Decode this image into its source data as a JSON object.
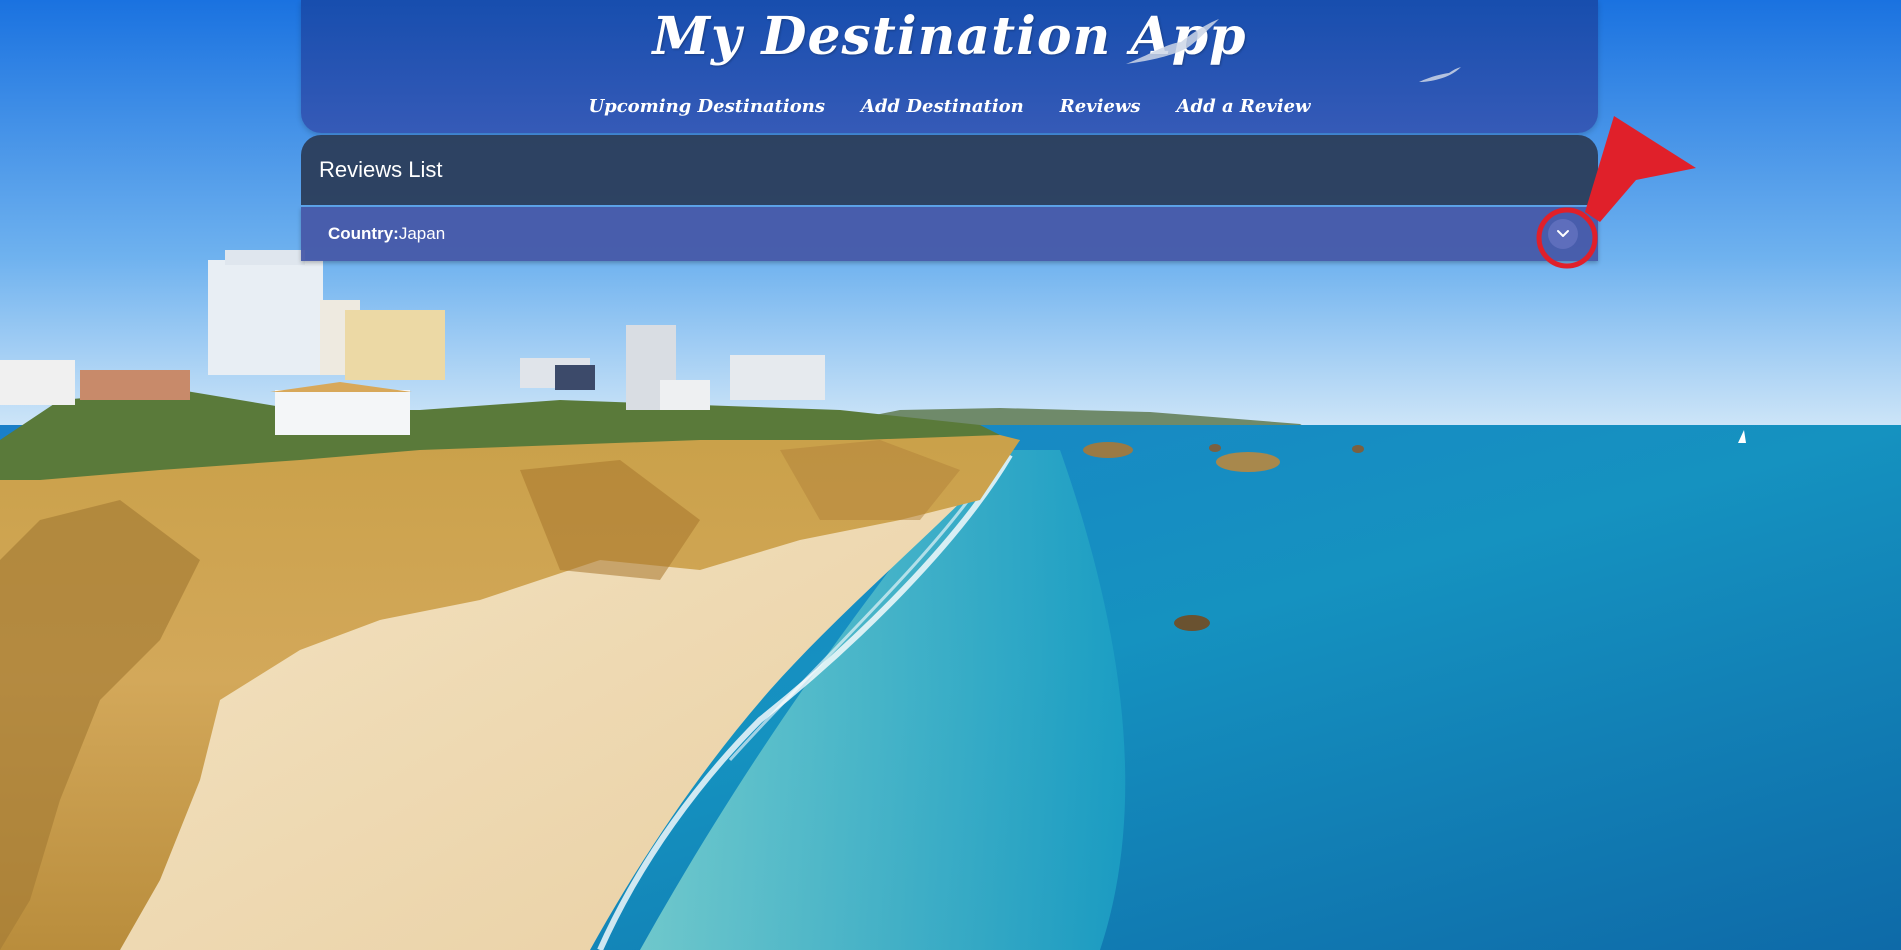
{
  "app": {
    "title": "My Destination App"
  },
  "nav": {
    "items": [
      {
        "label": "Upcoming Destinations"
      },
      {
        "label": "Add Destination"
      },
      {
        "label": "Reviews"
      },
      {
        "label": "Add a Review"
      }
    ]
  },
  "reviews": {
    "heading": "Reviews List",
    "items": [
      {
        "country_label": "Country:",
        "country_value": "Japan",
        "expand_icon": "chevron-down-icon"
      }
    ]
  },
  "colors": {
    "header_bg": "#1f4fad",
    "reviews_header_bg": "#2c3e5c",
    "review_row_bg": "#4658a8",
    "annotation": "#e0202a"
  }
}
